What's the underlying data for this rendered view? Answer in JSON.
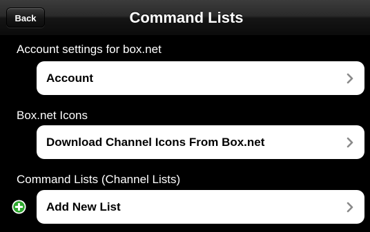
{
  "navbar": {
    "back_label": "Back",
    "title": "Command Lists"
  },
  "sections": [
    {
      "header": "Account settings for box.net",
      "cell_label": "Account"
    },
    {
      "header": "Box.net Icons",
      "cell_label": "Download Channel Icons From Box.net"
    },
    {
      "header": "Command Lists (Channel Lists)",
      "cell_label": "Add New List"
    }
  ],
  "icons": {
    "chevron": "chevron-right-icon",
    "add": "add-circle-icon"
  },
  "colors": {
    "background": "#000000",
    "cell": "#ffffff",
    "add_icon": "#2ea82e"
  }
}
